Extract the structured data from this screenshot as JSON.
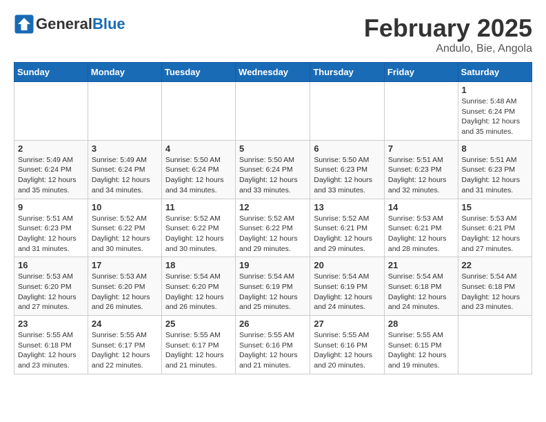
{
  "header": {
    "logo_general": "General",
    "logo_blue": "Blue",
    "month_title": "February 2025",
    "location": "Andulo, Bie, Angola"
  },
  "weekdays": [
    "Sunday",
    "Monday",
    "Tuesday",
    "Wednesday",
    "Thursday",
    "Friday",
    "Saturday"
  ],
  "weeks": [
    [
      {
        "day": "",
        "content": ""
      },
      {
        "day": "",
        "content": ""
      },
      {
        "day": "",
        "content": ""
      },
      {
        "day": "",
        "content": ""
      },
      {
        "day": "",
        "content": ""
      },
      {
        "day": "",
        "content": ""
      },
      {
        "day": "1",
        "content": "Sunrise: 5:48 AM\nSunset: 6:24 PM\nDaylight: 12 hours\nand 35 minutes."
      }
    ],
    [
      {
        "day": "2",
        "content": "Sunrise: 5:49 AM\nSunset: 6:24 PM\nDaylight: 12 hours\nand 35 minutes."
      },
      {
        "day": "3",
        "content": "Sunrise: 5:49 AM\nSunset: 6:24 PM\nDaylight: 12 hours\nand 34 minutes."
      },
      {
        "day": "4",
        "content": "Sunrise: 5:50 AM\nSunset: 6:24 PM\nDaylight: 12 hours\nand 34 minutes."
      },
      {
        "day": "5",
        "content": "Sunrise: 5:50 AM\nSunset: 6:24 PM\nDaylight: 12 hours\nand 33 minutes."
      },
      {
        "day": "6",
        "content": "Sunrise: 5:50 AM\nSunset: 6:23 PM\nDaylight: 12 hours\nand 33 minutes."
      },
      {
        "day": "7",
        "content": "Sunrise: 5:51 AM\nSunset: 6:23 PM\nDaylight: 12 hours\nand 32 minutes."
      },
      {
        "day": "8",
        "content": "Sunrise: 5:51 AM\nSunset: 6:23 PM\nDaylight: 12 hours\nand 31 minutes."
      }
    ],
    [
      {
        "day": "9",
        "content": "Sunrise: 5:51 AM\nSunset: 6:23 PM\nDaylight: 12 hours\nand 31 minutes."
      },
      {
        "day": "10",
        "content": "Sunrise: 5:52 AM\nSunset: 6:22 PM\nDaylight: 12 hours\nand 30 minutes."
      },
      {
        "day": "11",
        "content": "Sunrise: 5:52 AM\nSunset: 6:22 PM\nDaylight: 12 hours\nand 30 minutes."
      },
      {
        "day": "12",
        "content": "Sunrise: 5:52 AM\nSunset: 6:22 PM\nDaylight: 12 hours\nand 29 minutes."
      },
      {
        "day": "13",
        "content": "Sunrise: 5:52 AM\nSunset: 6:21 PM\nDaylight: 12 hours\nand 29 minutes."
      },
      {
        "day": "14",
        "content": "Sunrise: 5:53 AM\nSunset: 6:21 PM\nDaylight: 12 hours\nand 28 minutes."
      },
      {
        "day": "15",
        "content": "Sunrise: 5:53 AM\nSunset: 6:21 PM\nDaylight: 12 hours\nand 27 minutes."
      }
    ],
    [
      {
        "day": "16",
        "content": "Sunrise: 5:53 AM\nSunset: 6:20 PM\nDaylight: 12 hours\nand 27 minutes."
      },
      {
        "day": "17",
        "content": "Sunrise: 5:53 AM\nSunset: 6:20 PM\nDaylight: 12 hours\nand 26 minutes."
      },
      {
        "day": "18",
        "content": "Sunrise: 5:54 AM\nSunset: 6:20 PM\nDaylight: 12 hours\nand 26 minutes."
      },
      {
        "day": "19",
        "content": "Sunrise: 5:54 AM\nSunset: 6:19 PM\nDaylight: 12 hours\nand 25 minutes."
      },
      {
        "day": "20",
        "content": "Sunrise: 5:54 AM\nSunset: 6:19 PM\nDaylight: 12 hours\nand 24 minutes."
      },
      {
        "day": "21",
        "content": "Sunrise: 5:54 AM\nSunset: 6:18 PM\nDaylight: 12 hours\nand 24 minutes."
      },
      {
        "day": "22",
        "content": "Sunrise: 5:54 AM\nSunset: 6:18 PM\nDaylight: 12 hours\nand 23 minutes."
      }
    ],
    [
      {
        "day": "23",
        "content": "Sunrise: 5:55 AM\nSunset: 6:18 PM\nDaylight: 12 hours\nand 23 minutes."
      },
      {
        "day": "24",
        "content": "Sunrise: 5:55 AM\nSunset: 6:17 PM\nDaylight: 12 hours\nand 22 minutes."
      },
      {
        "day": "25",
        "content": "Sunrise: 5:55 AM\nSunset: 6:17 PM\nDaylight: 12 hours\nand 21 minutes."
      },
      {
        "day": "26",
        "content": "Sunrise: 5:55 AM\nSunset: 6:16 PM\nDaylight: 12 hours\nand 21 minutes."
      },
      {
        "day": "27",
        "content": "Sunrise: 5:55 AM\nSunset: 6:16 PM\nDaylight: 12 hours\nand 20 minutes."
      },
      {
        "day": "28",
        "content": "Sunrise: 5:55 AM\nSunset: 6:15 PM\nDaylight: 12 hours\nand 19 minutes."
      },
      {
        "day": "",
        "content": ""
      }
    ]
  ]
}
